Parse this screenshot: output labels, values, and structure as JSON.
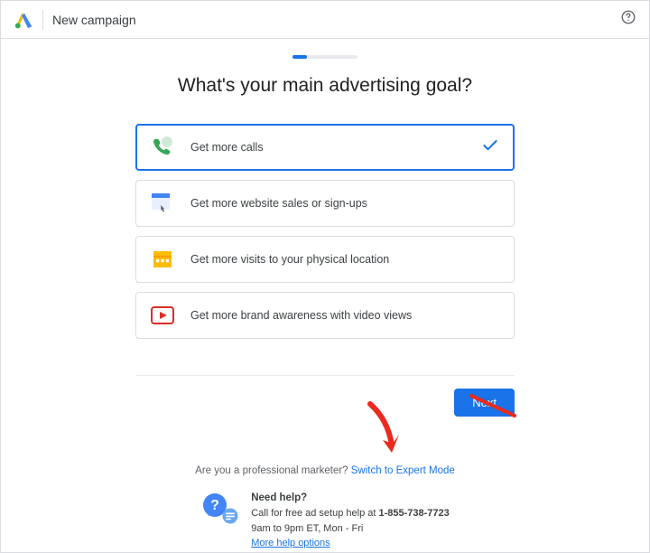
{
  "header": {
    "title": "New campaign"
  },
  "heading": "What's your main advertising goal?",
  "options": [
    {
      "label": "Get more calls",
      "selected": true
    },
    {
      "label": "Get more website sales or sign-ups",
      "selected": false
    },
    {
      "label": "Get more visits to your physical location",
      "selected": false
    },
    {
      "label": "Get more brand awareness with video views",
      "selected": false
    }
  ],
  "next_label": "Next",
  "expert": {
    "question": "Are you a professional marketer? ",
    "link": "Switch to Expert Mode"
  },
  "help": {
    "heading": "Need help?",
    "line1_prefix": "Call for free ad setup help at ",
    "phone": "1-855-738-7723",
    "hours": "9am to 9pm ET, Mon - Fri",
    "more": "More help options"
  }
}
